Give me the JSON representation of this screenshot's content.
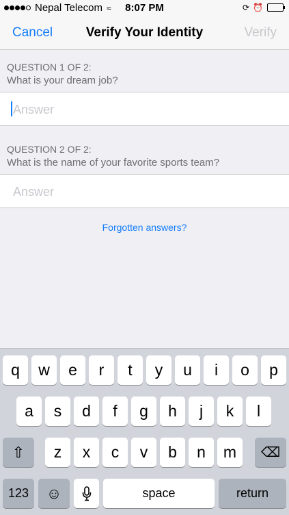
{
  "status_bar": {
    "carrier": "Nepal Telecom",
    "time": "8:07 PM"
  },
  "nav": {
    "cancel": "Cancel",
    "title": "Verify Your Identity",
    "verify": "Verify"
  },
  "questions": [
    {
      "counter": "QUESTION 1 OF 2:",
      "text": "What is your dream job?",
      "placeholder": "Answer",
      "value": ""
    },
    {
      "counter": "QUESTION 2 OF 2:",
      "text": "What is the name of your favorite sports team?",
      "placeholder": "Answer",
      "value": ""
    }
  ],
  "forgot_link": "Forgotten answers?",
  "keyboard": {
    "row1": [
      "q",
      "w",
      "e",
      "r",
      "t",
      "y",
      "u",
      "i",
      "o",
      "p"
    ],
    "row2": [
      "a",
      "s",
      "d",
      "f",
      "g",
      "h",
      "j",
      "k",
      "l"
    ],
    "row3": [
      "z",
      "x",
      "c",
      "v",
      "b",
      "n",
      "m"
    ],
    "numbers_key": "123",
    "space_key": "space",
    "return_key": "return"
  }
}
